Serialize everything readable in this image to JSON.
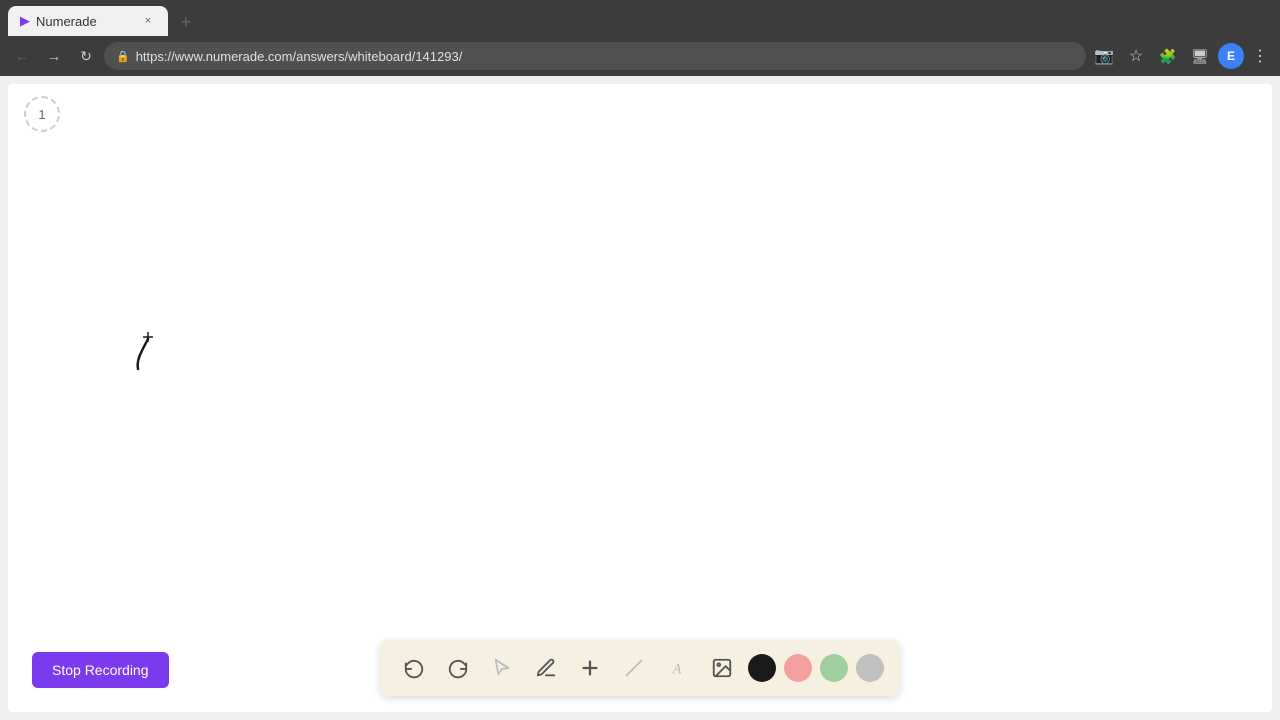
{
  "browser": {
    "tab": {
      "title": "Numerade",
      "favicon": "▶",
      "close_label": "×"
    },
    "new_tab_label": "+",
    "nav": {
      "back": "←",
      "forward": "→",
      "refresh": "↻",
      "url": "https://www.numerade.com/answers/whiteboard/141293/"
    },
    "toolbar_icons": {
      "cast": "📷",
      "star": "★",
      "extensions": "🧩",
      "display": "🖥",
      "profile_initial": "E",
      "more": "⋮"
    }
  },
  "whiteboard": {
    "page_number": "1",
    "stop_recording_label": "Stop Recording"
  },
  "drawing_toolbar": {
    "undo_label": "undo",
    "redo_label": "redo",
    "select_label": "select",
    "pen_label": "pen",
    "add_label": "add",
    "eraser_label": "eraser",
    "text_label": "text",
    "image_label": "image",
    "colors": [
      {
        "name": "black",
        "value": "#1a1a1a"
      },
      {
        "name": "pink",
        "value": "#f4a0a0"
      },
      {
        "name": "green",
        "value": "#a0d0a0"
      },
      {
        "name": "gray",
        "value": "#c0c0c0"
      }
    ]
  }
}
